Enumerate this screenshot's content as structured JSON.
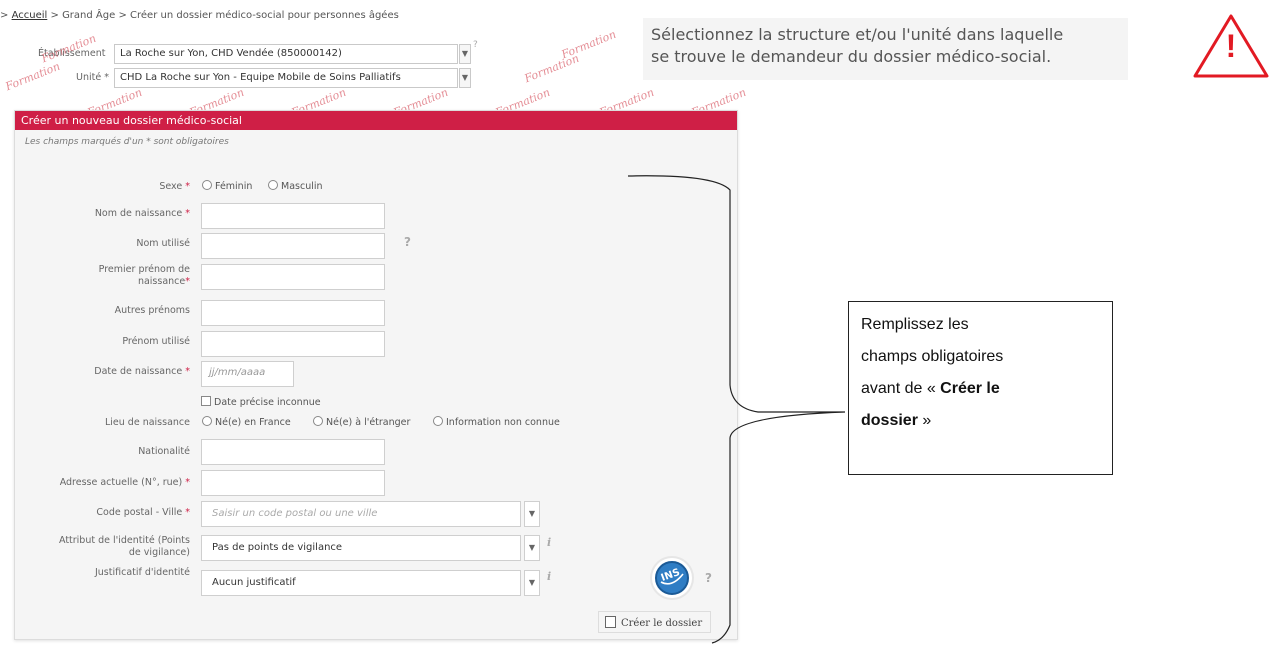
{
  "breadcrumb": {
    "prefix": ">",
    "home": "Accueil",
    "sep1": ">",
    "section": "Grand Âge",
    "sep2": ">",
    "current": "Créer un dossier médico-social pour personnes âgées"
  },
  "header": {
    "etablissement_label": "Établissement",
    "etablissement_value": "La Roche sur Yon, CHD Vendée (850000142)",
    "unite_label": "Unité *",
    "unite_value": "CHD La Roche sur Yon - Equipe Mobile de Soins Palliatifs"
  },
  "watermark": {
    "text": "Formation"
  },
  "instruction": {
    "line1": "Sélectionnez la structure et/ou l'unité dans laquelle",
    "line2": "se trouve le demandeur du dossier médico-social."
  },
  "warning": {
    "symbol": "!"
  },
  "panel": {
    "title": "Créer un nouveau dossier médico-social",
    "required_note": "Les champs marqués d'un * sont obligatoires"
  },
  "form": {
    "sexe_label": "Sexe",
    "sexe_options": [
      "Féminin",
      "Masculin"
    ],
    "nom_naissance_label": "Nom de naissance",
    "nom_utilise_label": "Nom utilisé",
    "premier_prenom_label_1": "Premier prénom de",
    "premier_prenom_label_2": "naissance",
    "autres_prenoms_label": "Autres prénoms",
    "prenom_utilise_label": "Prénom utilisé",
    "date_naissance_label": "Date de naissance",
    "date_naissance_placeholder": "jj/mm/aaaa",
    "date_inconnue_label": "Date précise inconnue",
    "lieu_naissance_label": "Lieu de naissance",
    "lieu_options": [
      "Né(e) en France",
      "Né(e) à l'étranger",
      "Information non connue"
    ],
    "nationalite_label": "Nationalité",
    "adresse_label": "Adresse actuelle (N°, rue)",
    "code_postal_label": "Code postal - Ville",
    "code_postal_placeholder": "Saisir un code postal ou une ville",
    "attribut_label_1": "Attribut de l'identité (Points",
    "attribut_label_2": "de vigilance)",
    "attribut_value": "Pas de points de vigilance",
    "justificatif_label": "Justificatif d'identité",
    "justificatif_value": "Aucun justificatif",
    "required_mark": "*",
    "help_mark": "?",
    "info_mark": "i",
    "create_button": "Créer le dossier",
    "ins_badge_text": "INS"
  },
  "callout": {
    "line1": "Remplissez les",
    "line2": "champs obligatoires",
    "line3_prefix": "avant de « ",
    "line3_bold": "Créer le",
    "line4_bold": "dossier",
    "line4_suffix": " »"
  },
  "colors": {
    "panel_header": "#cf1f46",
    "watermark": "#cd2d3c",
    "warning": "#e21a23"
  }
}
